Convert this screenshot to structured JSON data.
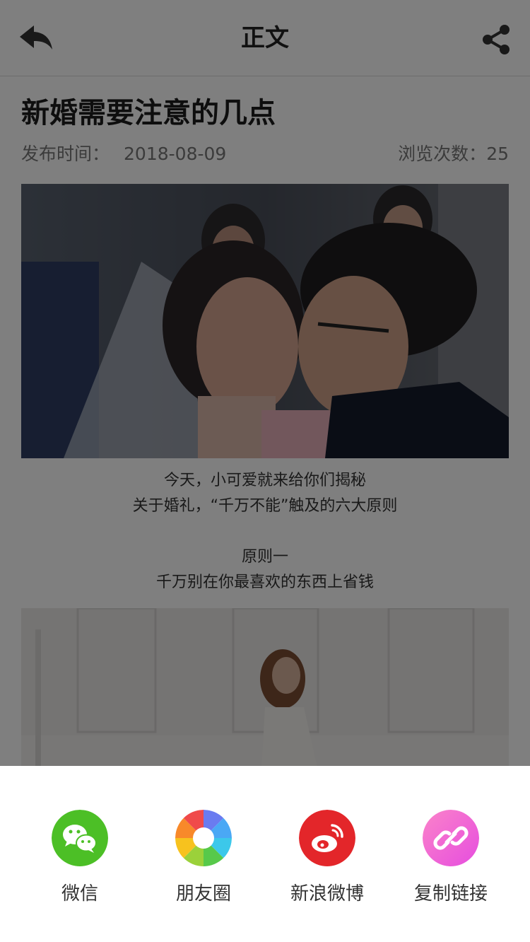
{
  "header": {
    "title": "正文",
    "back_icon": "back-arrow-icon",
    "share_icon": "share-icon"
  },
  "article": {
    "title": "新婚需要注意的几点",
    "publish_label": "发布时间：",
    "publish_date": "2018-08-09",
    "views_label": "浏览次数：",
    "views_count": "25",
    "paragraphs": [
      "今天，小可爱就来给你们揭秘",
      "关于婚礼，“千万不能”触及的六大原则",
      "原则一",
      "千万别在你最喜欢的东西上省钱"
    ]
  },
  "share_sheet": {
    "items": [
      {
        "label": "微信",
        "icon": "wechat-icon",
        "color": "#4cbf26"
      },
      {
        "label": "朋友圈",
        "icon": "moments-icon",
        "color": "#ffffff"
      },
      {
        "label": "新浪微博",
        "icon": "weibo-icon",
        "color": "#e3262a"
      },
      {
        "label": "复制链接",
        "icon": "link-icon",
        "color": "#f760b8"
      }
    ]
  },
  "colors": {
    "overlay": "rgba(0,0,0,0.5)",
    "wechat": "#4cbf26",
    "weibo": "#e3262a",
    "link_gradient": [
      "#fb83c9",
      "#e64ddf"
    ]
  }
}
